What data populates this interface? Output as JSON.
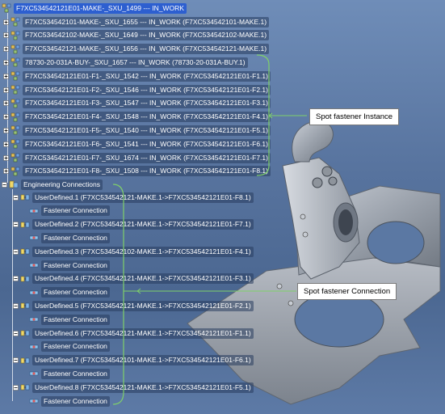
{
  "tree": {
    "root_label": "F7XC534542121E01-MAKE-_SXU_1499 --- IN_WORK",
    "instances": [
      "F7XC534542101-MAKE-_SXU_1655 --- IN_WORK (F7XC534542101-MAKE.1)",
      "F7XC534542102-MAKE-_SXU_1649 --- IN_WORK (F7XC534542102-MAKE.1)",
      "F7XC534542121-MAKE-_SXU_1656 --- IN_WORK (F7XC534542121-MAKE.1)",
      "78730-20-031A-BUY-_SXU_1657 --- IN_WORK (78730-20-031A-BUY.1)",
      "F7XC534542121E01-F1-_SXU_1542 --- IN_WORK (F7XC534542121E01-F1.1)",
      "F7XC534542121E01-F2-_SXU_1546 --- IN_WORK (F7XC534542121E01-F2.1)",
      "F7XC534542121E01-F3-_SXU_1547 --- IN_WORK (F7XC534542121E01-F3.1)",
      "F7XC534542121E01-F4-_SXU_1548 --- IN_WORK (F7XC534542121E01-F4.1)",
      "F7XC534542121E01-F5-_SXU_1540 --- IN_WORK (F7XC534542121E01-F5.1)",
      "F7XC534542121E01-F6-_SXU_1541 --- IN_WORK (F7XC534542121E01-F6.1)",
      "F7XC534542121E01-F7-_SXU_1674 --- IN_WORK (F7XC534542121E01-F7.1)",
      "F7XC534542121E01-F8-_SXU_1508 --- IN_WORK (F7XC534542121E01-F8.1)"
    ],
    "engineering_label": "Engineering Connections",
    "connections": [
      {
        "label": "UserDefined.1 (F7XC534542121-MAKE.1->F7XC534542121E01-F8.1)",
        "child": "Fastener Connection"
      },
      {
        "label": "UserDefined.2 (F7XC534542121-MAKE.1->F7XC534542121E01-F7.1)",
        "child": "Fastener Connection"
      },
      {
        "label": "UserDefined.3 (F7XC534542102-MAKE.1->F7XC534542121E01-F4.1)",
        "child": "Fastener Connection"
      },
      {
        "label": "UserDefined.4 (F7XC534542121-MAKE.1->F7XC534542121E01-F3.1)",
        "child": "Fastener Connection"
      },
      {
        "label": "UserDefined.5 (F7XC534542121-MAKE.1->F7XC534542121E01-F2.1)",
        "child": "Fastener Connection"
      },
      {
        "label": "UserDefined.6 (F7XC534542121-MAKE.1->F7XC534542121E01-F1.1)",
        "child": "Fastener Connection"
      },
      {
        "label": "UserDefined.7 (F7XC534542101-MAKE.1->F7XC534542121E01-F6.1)",
        "child": "Fastener Connection"
      },
      {
        "label": "UserDefined.8 (F7XC534542121-MAKE.1->F7XC534542121E01-F5.1)",
        "child": "Fastener Connection"
      }
    ]
  },
  "callouts": {
    "instance": "Spot fastener Instance",
    "connection": "Spot fastener Connection"
  },
  "icons": {
    "product": "product-icon",
    "engineering": "engineering-connections-icon",
    "userdefined": "user-defined-connection-icon",
    "fastener": "fastener-connection-icon"
  },
  "colors": {
    "selection": "#2d5fd0",
    "background_top": "#6f8db8",
    "background_bottom": "#4b6791",
    "bracket_line": "#7fd06a"
  }
}
